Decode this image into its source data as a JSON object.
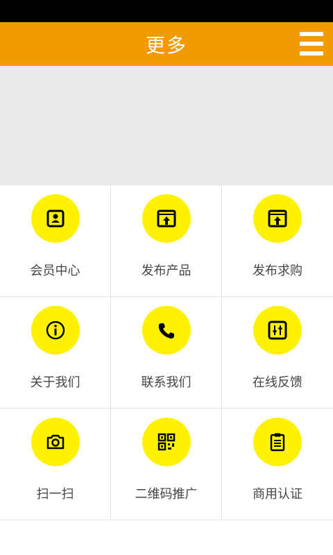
{
  "header": {
    "title": "更多"
  },
  "grid": {
    "items": [
      {
        "label": "会员中心",
        "icon": "member-icon"
      },
      {
        "label": "发布产品",
        "icon": "publish-product-icon"
      },
      {
        "label": "发布求购",
        "icon": "publish-request-icon"
      },
      {
        "label": "关于我们",
        "icon": "info-icon"
      },
      {
        "label": "联系我们",
        "icon": "phone-icon"
      },
      {
        "label": "在线反馈",
        "icon": "feedback-icon"
      },
      {
        "label": "扫一扫",
        "icon": "camera-icon"
      },
      {
        "label": "二维码推广",
        "icon": "qrcode-icon"
      },
      {
        "label": "商用认证",
        "icon": "clipboard-icon"
      }
    ]
  },
  "colors": {
    "accent": "#f29a00",
    "icon_bg": "#fff200",
    "status_bar": "#000000"
  }
}
